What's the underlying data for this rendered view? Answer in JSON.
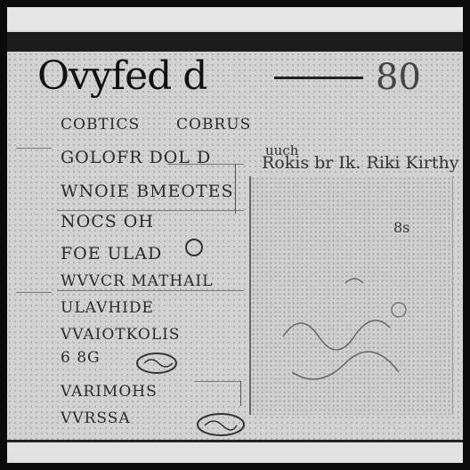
{
  "document": {
    "title": "Ovyfed d",
    "number": "80",
    "right_header_small": "uuch",
    "right_header": "Rokis br Ik. Riki Kirthy",
    "right_note": "8s",
    "rows": [
      "COBTICS",
      "GOLOFR DOL D",
      "WNOIE BMEOTES",
      "NOCS OH",
      "FOE ULAD",
      "WVVCR MATHAIL",
      "ULAVHIDE",
      "VVAIOTKOLIS",
      "6 8G",
      "VARIMOHS",
      "VVRSSA"
    ],
    "row_right": "COBRUS"
  }
}
